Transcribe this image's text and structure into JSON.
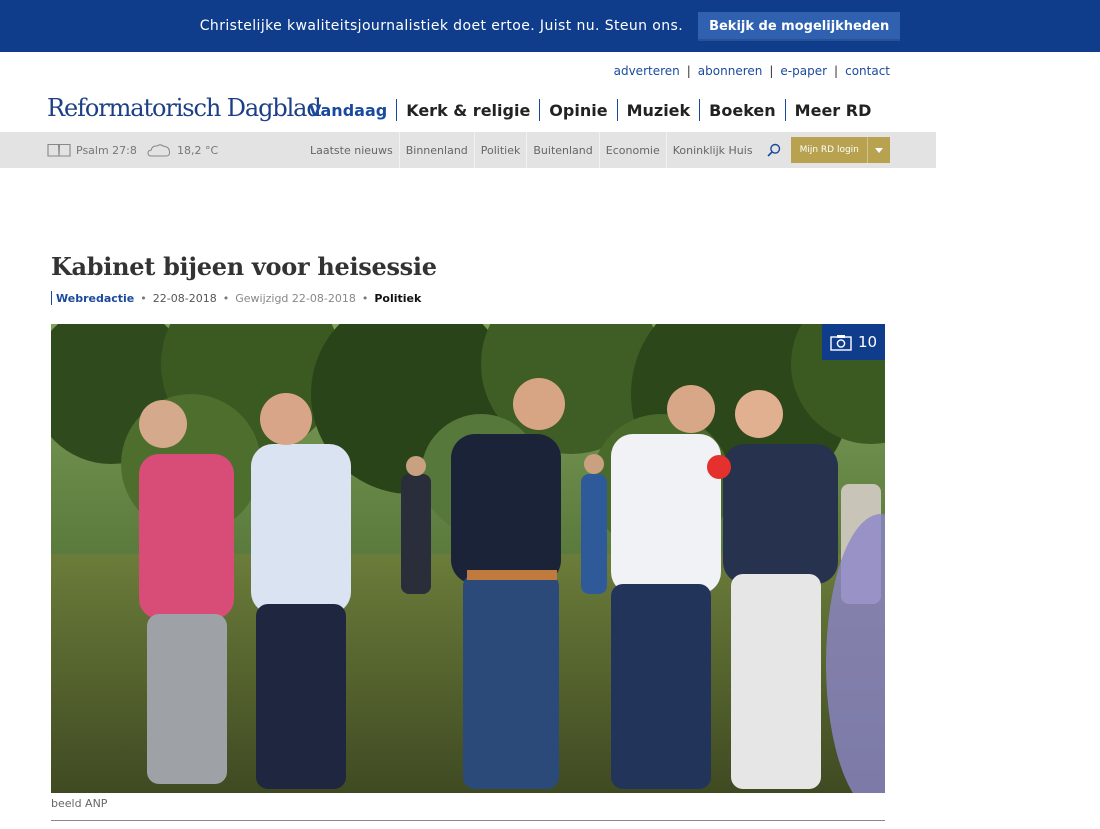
{
  "banner": {
    "text": "Christelijke kwaliteitsjournalistiek doet ertoe. Juist nu. Steun ons.",
    "button_label": "Bekijk de mogelijkheden"
  },
  "utility_links": [
    "adverteren",
    "abonneren",
    "e-paper",
    "contact"
  ],
  "site": {
    "logo": "Reformatorisch Dagblad"
  },
  "main_nav": [
    {
      "label": "Vandaag",
      "active": true
    },
    {
      "label": "Kerk & religie"
    },
    {
      "label": "Opinie"
    },
    {
      "label": "Muziek"
    },
    {
      "label": "Boeken"
    },
    {
      "label": "Meer RD"
    }
  ],
  "subbar": {
    "psalm": "Psalm 27:8",
    "weather": "18,2 °C",
    "links": [
      "Laatste nieuws",
      "Binnenland",
      "Politiek",
      "Buitenland",
      "Economie",
      "Koninklijk Huis"
    ],
    "login_label": "Mijn RD login"
  },
  "article": {
    "title": "Kabinet bijeen voor heisessie",
    "author": "Webredactie",
    "date": "22-08-2018",
    "edited": "Gewijzigd 22-08-2018",
    "section": "Politiek",
    "photo_count": "10",
    "caption": "beeld ANP"
  },
  "colors": {
    "brand_blue": "#0f3d8c",
    "link_blue": "#1a4a9e",
    "login_gold": "#b8a24f"
  }
}
